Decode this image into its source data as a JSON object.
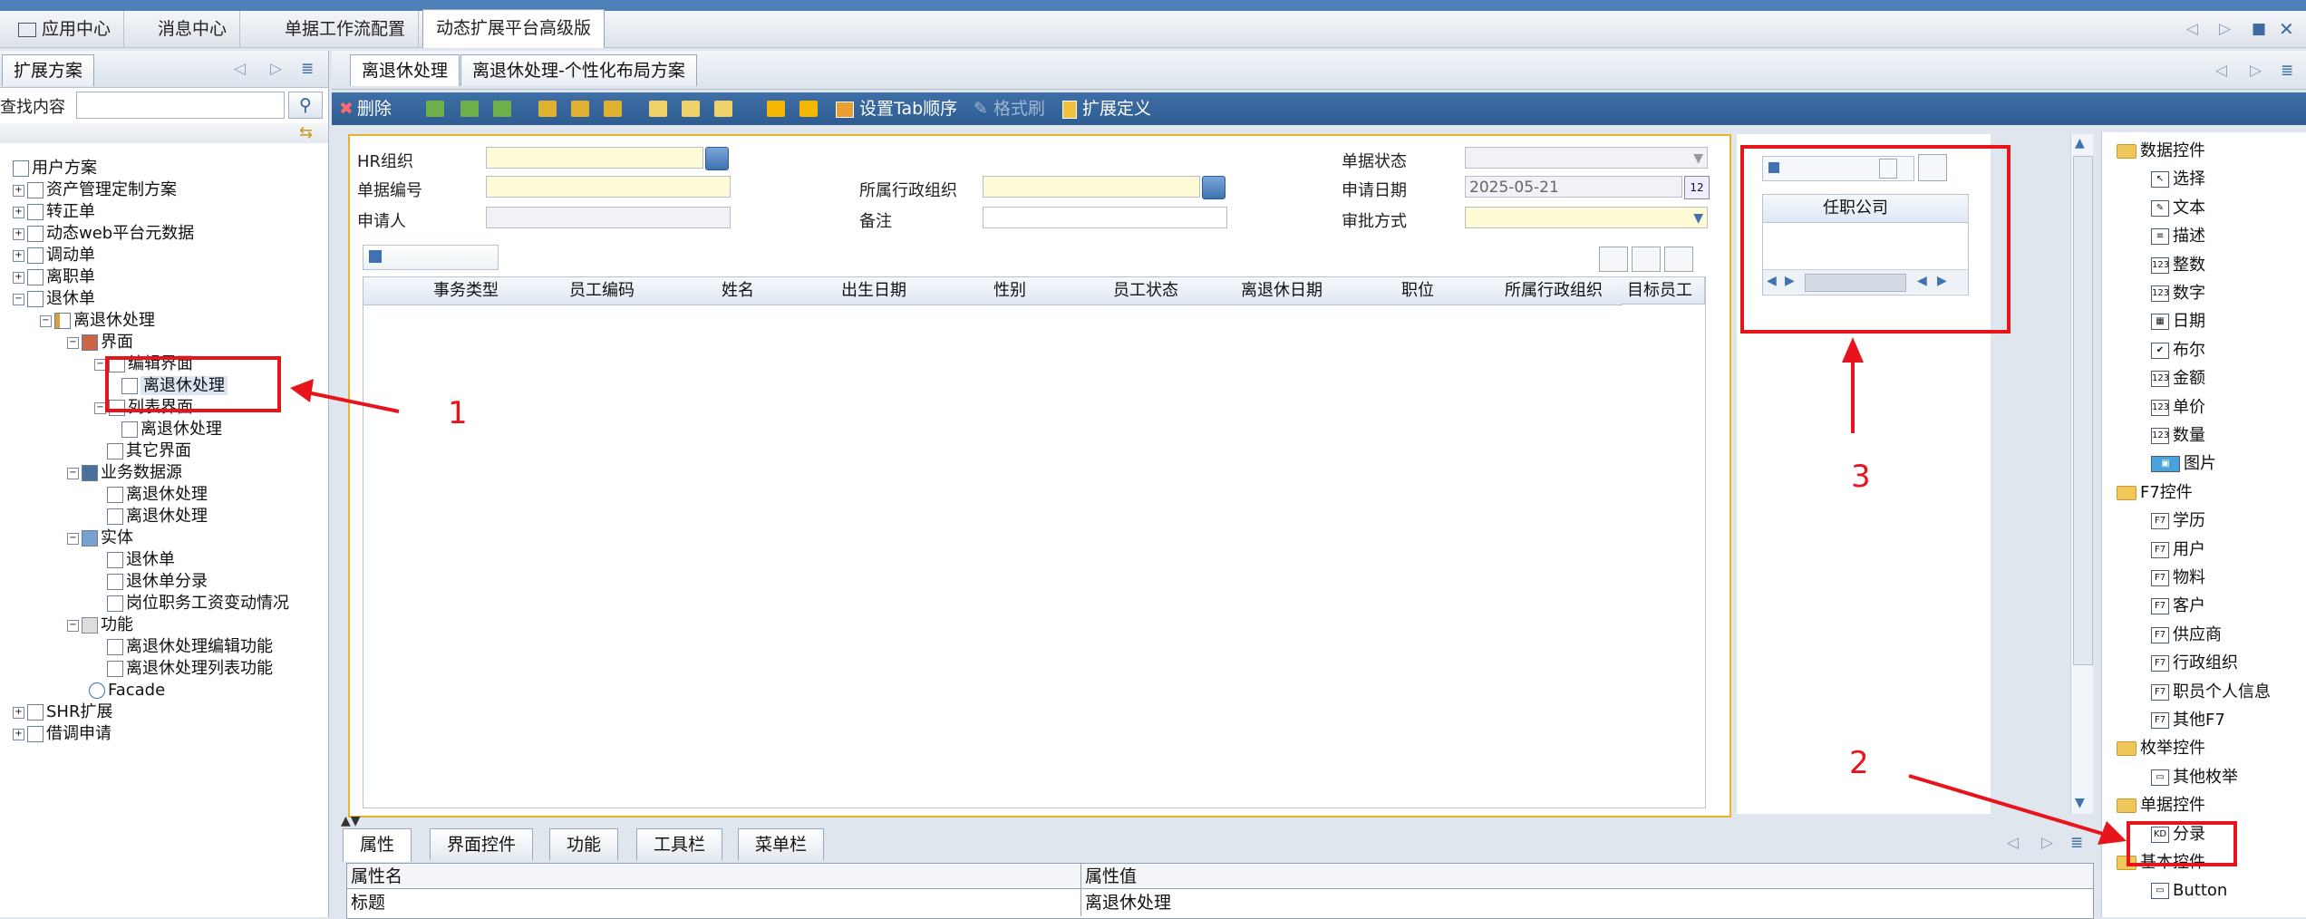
{
  "app_tabs": [
    "应用中心",
    "消息中心",
    "单据工作流配置",
    "动态扩展平台高级版"
  ],
  "left_panel": {
    "tab": "扩展方案",
    "search_label": "查找内容",
    "search_value": "",
    "tree": [
      {
        "label": "用户方案"
      },
      {
        "label": "资产管理定制方案"
      },
      {
        "label": "转正单"
      },
      {
        "label": "动态web平台元数据"
      },
      {
        "label": "调动单"
      },
      {
        "label": "离职单"
      },
      {
        "label": "退休单"
      },
      {
        "label": "离退休处理"
      },
      {
        "label": "界面"
      },
      {
        "label": "编辑界面"
      },
      {
        "label": "离退休处理"
      },
      {
        "label": "列表界面"
      },
      {
        "label": "离退休处理"
      },
      {
        "label": "其它界面"
      },
      {
        "label": "业务数据源"
      },
      {
        "label": "离退休处理"
      },
      {
        "label": "离退休处理"
      },
      {
        "label": "实体"
      },
      {
        "label": "退休单"
      },
      {
        "label": "退休单分录"
      },
      {
        "label": "岗位职务工资变动情况"
      },
      {
        "label": "功能"
      },
      {
        "label": "离退休处理编辑功能"
      },
      {
        "label": "离退休处理列表功能"
      },
      {
        "label": "Facade"
      },
      {
        "label": "SHR扩展"
      },
      {
        "label": "借调申请"
      }
    ]
  },
  "center_tabs": [
    "离退休处理",
    "离退休处理-个性化布局方案"
  ],
  "toolbar": {
    "delete": "删除",
    "tab_order": "设置Tab顺序",
    "format_brush": "格式刷",
    "ext_def": "扩展定义"
  },
  "form": {
    "hr_org_label": "HR组织",
    "bill_no_label": "单据编号",
    "applicant_label": "申请人",
    "admin_org_label": "所属行政组织",
    "remark_label": "备注",
    "bill_status_label": "单据状态",
    "apply_date_label": "申请日期",
    "apply_date_value": "2025-05-21",
    "approval_label": "审批方式"
  },
  "grid_columns": [
    "事务类型",
    "员工编码",
    "姓名",
    "出生日期",
    "性别",
    "员工状态",
    "离退休日期",
    "职位",
    "所属行政组织",
    "目标员工"
  ],
  "preview_column": "任职公司",
  "palette": [
    {
      "label": "数据控件",
      "type": "folder"
    },
    {
      "label": "选择",
      "icon": "cursor"
    },
    {
      "label": "文本",
      "icon": "text"
    },
    {
      "label": "描述",
      "icon": "desc"
    },
    {
      "label": "整数",
      "icon": "num"
    },
    {
      "label": "数字",
      "icon": "num"
    },
    {
      "label": "日期",
      "icon": "date"
    },
    {
      "label": "布尔",
      "icon": "bool"
    },
    {
      "label": "金额",
      "icon": "num"
    },
    {
      "label": "单价",
      "icon": "num"
    },
    {
      "label": "数量",
      "icon": "num"
    },
    {
      "label": "图片",
      "icon": "image"
    },
    {
      "label": "F7控件",
      "type": "folder"
    },
    {
      "label": "学历",
      "icon": "f7"
    },
    {
      "label": "用户",
      "icon": "f7"
    },
    {
      "label": "物料",
      "icon": "f7"
    },
    {
      "label": "客户",
      "icon": "f7"
    },
    {
      "label": "供应商",
      "icon": "f7"
    },
    {
      "label": "行政组织",
      "icon": "f7"
    },
    {
      "label": "职员个人信息",
      "icon": "f7"
    },
    {
      "label": "其他F7",
      "icon": "f7"
    },
    {
      "label": "枚举控件",
      "type": "folder"
    },
    {
      "label": "其他枚举",
      "icon": "enum"
    },
    {
      "label": "单据控件",
      "type": "folder"
    },
    {
      "label": "分录",
      "icon": "kd"
    },
    {
      "label": "基本控件",
      "type": "folder"
    },
    {
      "label": "Button",
      "icon": "button"
    }
  ],
  "bottom_tabs": [
    "属性",
    "界面控件",
    "功能",
    "工具栏",
    "菜单栏"
  ],
  "prop_table": {
    "col_name": "属性名",
    "col_value": "属性值",
    "row_name": "标题",
    "row_value": "离退休处理"
  },
  "annotations": [
    "1",
    "2",
    "3"
  ],
  "colors": {
    "highlight": "#e8141c",
    "toolbar": "#3e6fa6",
    "required_field": "#fffbd6"
  }
}
